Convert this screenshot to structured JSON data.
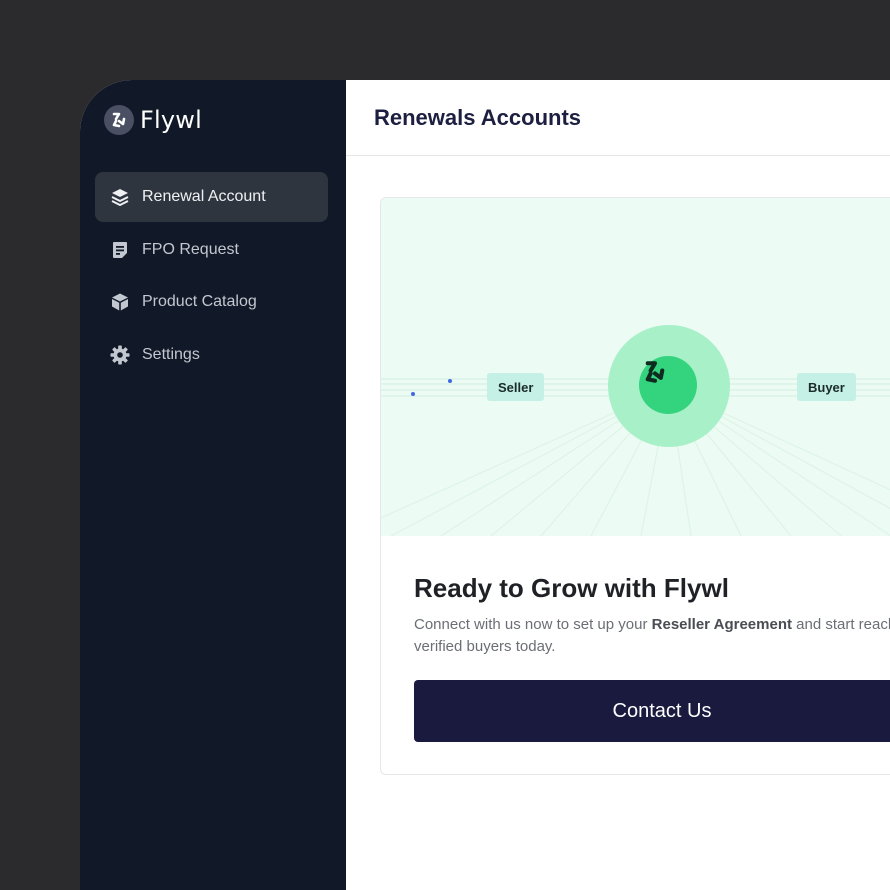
{
  "brand": {
    "name": "Flywl",
    "logo_icon": "flywl-pinwheel-logo"
  },
  "sidebar": {
    "items": [
      {
        "label": "Renewal Account",
        "icon": "layers-icon",
        "active": true
      },
      {
        "label": "FPO Request",
        "icon": "document-icon",
        "active": false
      },
      {
        "label": "Product Catalog",
        "icon": "cube-icon",
        "active": false
      },
      {
        "label": "Settings",
        "icon": "gear-icon",
        "active": false
      }
    ]
  },
  "header": {
    "title": "Renewals Accounts"
  },
  "card": {
    "hero": {
      "seller_label": "Seller",
      "buyer_label": "Buyer",
      "hub_icon": "flywl-pinwheel-logo"
    },
    "title": "Ready to Grow with Flywl",
    "description_before": "Connect with us now to set up your ",
    "description_bold": "Reseller Agreement",
    "description_after": " and start reaching verified buyers today.",
    "cta_label": "Contact Us"
  },
  "colors": {
    "sidebar_bg": "#111827",
    "active_item_bg": "#2f353f",
    "hero_bg": "#ecfbf3",
    "hub_outer": "#a7f0c8",
    "hub_inner": "#34d37e",
    "cta_bg": "#1a1a3f",
    "page_bg": "#2b2a2d"
  }
}
